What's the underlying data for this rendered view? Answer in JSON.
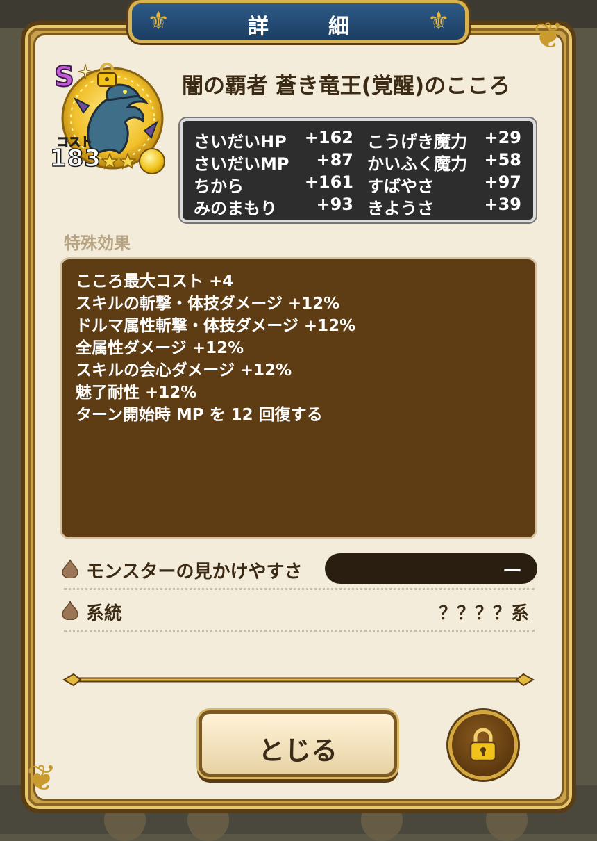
{
  "dialog": {
    "title": "詳　細"
  },
  "heart": {
    "rank": "S",
    "cost_label": "コスト",
    "cost": "183",
    "name": "闇の覇者 蒼き竜王(覚醒)のこころ"
  },
  "stats": [
    {
      "name": "さいだいHP",
      "value": "+162"
    },
    {
      "name": "こうげき魔力",
      "value": "+29"
    },
    {
      "name": "さいだいMP",
      "value": "+87"
    },
    {
      "name": "かいふく魔力",
      "value": "+58"
    },
    {
      "name": "ちから",
      "value": "+161"
    },
    {
      "name": "すばやさ",
      "value": "+97"
    },
    {
      "name": "みのまもり",
      "value": "+93"
    },
    {
      "name": "きようさ",
      "value": "+39"
    }
  ],
  "special": {
    "label": "特殊効果",
    "effects": [
      "こころ最大コスト +4",
      "スキルの斬撃・体技ダメージ +12%",
      "ドルマ属性斬撃・体技ダメージ +12%",
      "全属性ダメージ +12%",
      "スキルの会心ダメージ +12%",
      "魅了耐性 +12%",
      "ターン開始時 MP を 12 回復する"
    ]
  },
  "visibility": {
    "label": "モンスターの見かけやすさ",
    "value": "ー"
  },
  "lineage": {
    "label": "系統",
    "value": "？？？？系"
  },
  "buttons": {
    "close": "とじる"
  },
  "colors": {
    "panel": "#f4ecda",
    "frame_gold": "#c9a24a",
    "title_blue": "#1c3e63",
    "effects_bg": "#5e3d14",
    "stats_bg": "#2d2d2d"
  }
}
